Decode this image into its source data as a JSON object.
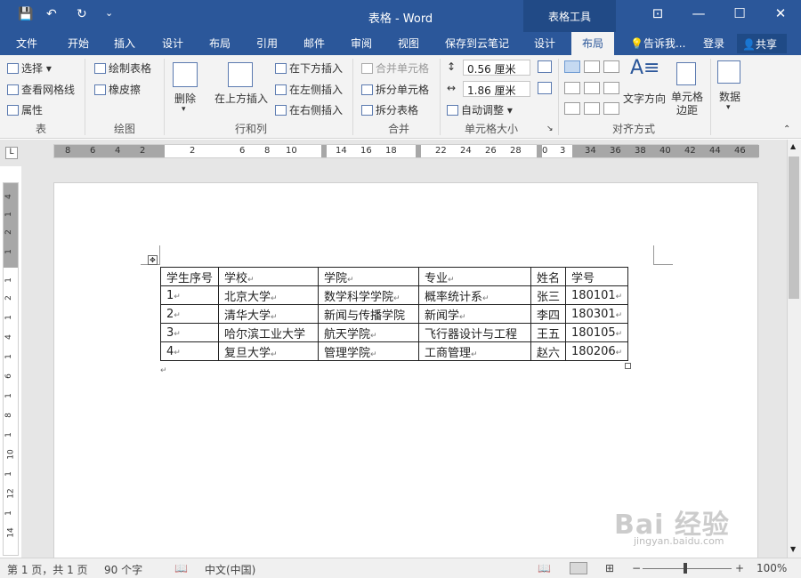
{
  "titlebar": {
    "title": "表格 - Word",
    "context_tools": "表格工具",
    "save_icon": "save-icon",
    "undo_icon": "undo-icon",
    "redo_icon": "redo-icon",
    "save_glyph": "💾",
    "undo_glyph": "↶",
    "redo_glyph": "↻",
    "customize_glyph": "⌄",
    "ribbon_display_glyph": "⊡",
    "minimize_glyph": "—",
    "maximize_glyph": "☐",
    "close_glyph": "✕"
  },
  "tabs": [
    "文件",
    "开始",
    "插入",
    "设计",
    "布局",
    "引用",
    "邮件",
    "审阅",
    "视图",
    "保存到云笔记",
    "设计",
    "布局"
  ],
  "tell_me": "告诉我...",
  "login": "登录",
  "share": "共享",
  "ribbon": {
    "table_group": {
      "label": "表",
      "select": "选择",
      "view_gridlines": "查看网格线",
      "properties": "属性"
    },
    "draw_group": {
      "label": "绘图",
      "draw_table": "绘制表格",
      "eraser": "橡皮擦"
    },
    "rows_cols_group": {
      "label": "行和列",
      "delete": "删除",
      "insert_above": "在上方插入",
      "insert_below": "在下方插入",
      "insert_left": "在左侧插入",
      "insert_right": "在右侧插入"
    },
    "merge_group": {
      "label": "合并",
      "merge_cells": "合并单元格",
      "split_cells": "拆分单元格",
      "split_table": "拆分表格"
    },
    "cell_size_group": {
      "label": "单元格大小",
      "height": "0.56 厘米",
      "width": "1.86 厘米",
      "autofit": "自动调整"
    },
    "alignment_group": {
      "label": "对齐方式",
      "text_direction": "文字方向",
      "cell_margins": "单元格边距"
    },
    "data": "数据"
  },
  "ruler_ticks": [
    "8",
    "6",
    "4",
    "2",
    "2",
    "6",
    "8",
    "10",
    "14",
    "16",
    "18",
    "22",
    "24",
    "26",
    "28",
    "0",
    "3",
    "34",
    "36",
    "38",
    "40",
    "42",
    "44",
    "46"
  ],
  "vruler_ticks": [
    "4",
    "1",
    "2",
    "1",
    "1",
    "2",
    "1",
    "4",
    "1",
    "6",
    "1",
    "8",
    "1",
    "10",
    "1",
    "12",
    "1",
    "14"
  ],
  "table": {
    "rows": [
      [
        "学生序号",
        "学校",
        "学院",
        "专业",
        "姓名",
        "学号"
      ],
      [
        "1",
        "北京大学",
        "数学科学学院",
        "概率统计系",
        "张三",
        "180101"
      ],
      [
        "2",
        "清华大学",
        "新闻与传播学院",
        "新闻学",
        "李四",
        "180301"
      ],
      [
        "3",
        "哈尔滨工业大学",
        "航天学院",
        "飞行器设计与工程",
        "王五",
        "180105"
      ],
      [
        "4",
        "复旦大学",
        "管理学院",
        "工商管理",
        "赵六",
        "180206"
      ]
    ]
  },
  "status": {
    "page": "第 1 页，共 1 页",
    "words": "90 个字",
    "language": "中文(中国)",
    "zoom": "100%"
  },
  "watermark": {
    "main": "Bai 经验",
    "sub": "jingyan.baidu.com"
  },
  "colors": {
    "accent": "#2b579a",
    "context": "#214a86"
  }
}
